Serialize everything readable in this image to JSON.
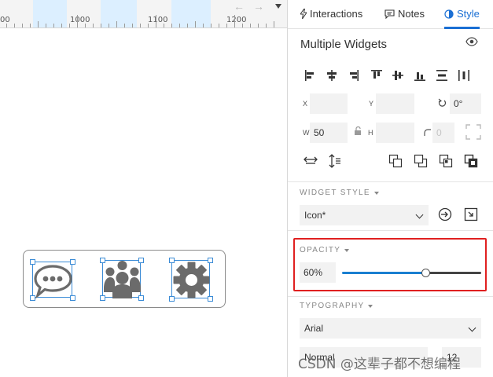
{
  "ruler": {
    "labels": [
      "00",
      "1000",
      "1100",
      "1200"
    ],
    "back_arrow": "←",
    "forward_arrow": "→"
  },
  "canvas": {
    "icons": [
      "speech-bubble-icon",
      "users-icon",
      "gear-icon"
    ],
    "icon_color": "#6b6b6b",
    "selection_color": "#3a8bd6"
  },
  "panel": {
    "tabs": [
      {
        "label": "Interactions",
        "icon": "lightning-icon"
      },
      {
        "label": "Notes",
        "icon": "comment-icon"
      },
      {
        "label": "Style",
        "icon": "style-drop-icon",
        "active": true
      }
    ],
    "title": "Multiple Widgets",
    "position": {
      "x_label": "X",
      "x_value": "",
      "y_label": "Y",
      "y_value": "",
      "rotation_value": "0°"
    },
    "size": {
      "w_label": "W",
      "w_value": "50",
      "h_label": "H",
      "h_value": "",
      "corner_value": "0"
    },
    "widget_style": {
      "title": "WIDGET STYLE",
      "selected": "Icon*"
    },
    "opacity": {
      "title": "OPACITY",
      "value": "60%",
      "fraction": 0.6
    },
    "typography": {
      "title": "TYPOGRAPHY",
      "font": "Arial",
      "weight": "Normal",
      "size": "12"
    }
  },
  "watermark": "CSDN @这辈子都不想编程",
  "colors": {
    "accent": "#1a6fd4",
    "highlight_border": "#e02020"
  }
}
